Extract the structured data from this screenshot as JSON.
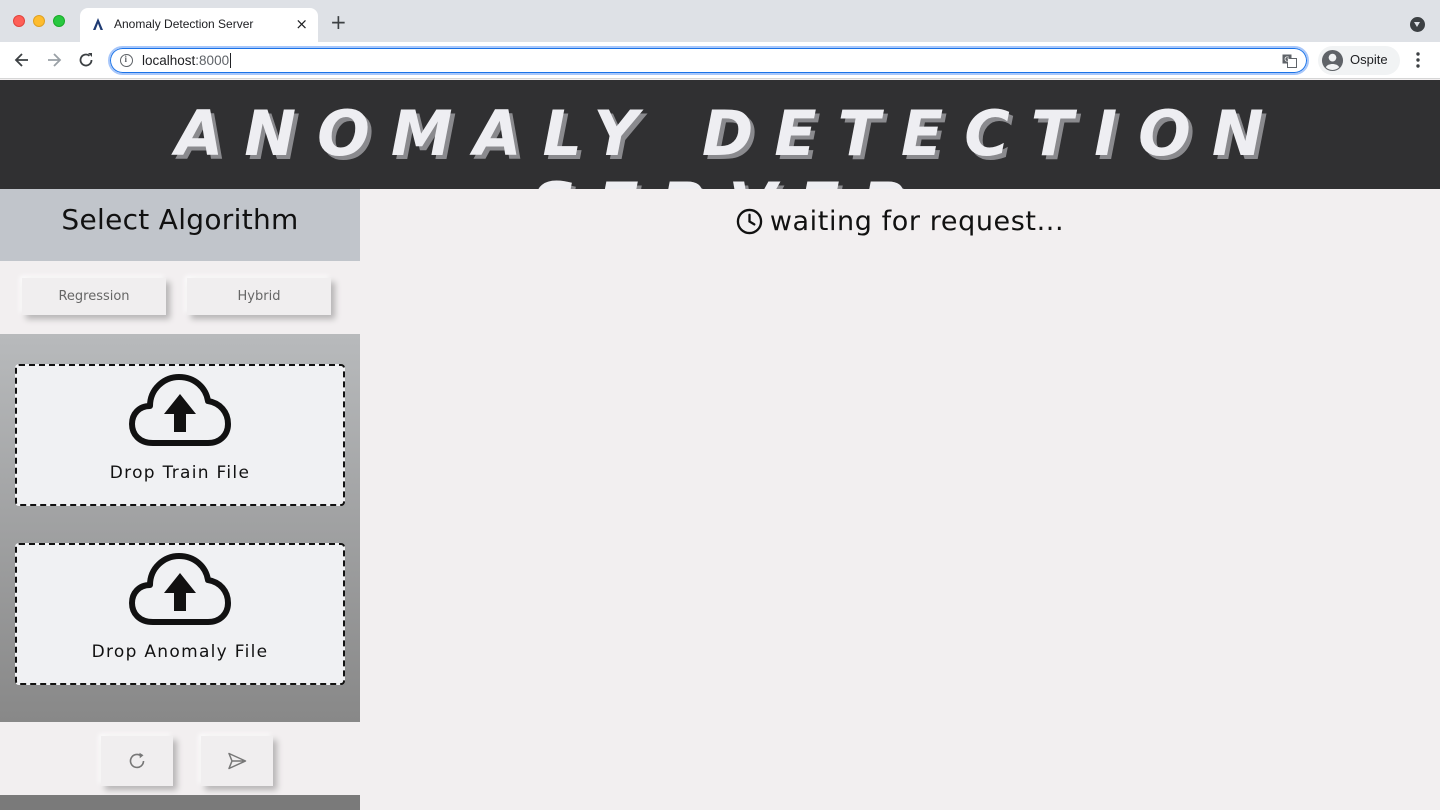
{
  "browser": {
    "tab_title": "Anomaly Detection Server",
    "tab_close": "×",
    "new_tab": "+",
    "url_host": "localhost",
    "url_port": ":8000",
    "profile_name": "Ospite"
  },
  "header": {
    "title": "ANOMALY DETECTION SERVER"
  },
  "sidebar": {
    "title": "Select Algorithm",
    "algorithms": [
      "Regression",
      "Hybrid"
    ],
    "drop_train_label": "Drop Train File",
    "drop_anomaly_label": "Drop Anomaly File"
  },
  "main": {
    "status": "waiting for request..."
  },
  "icons": {
    "upload": "cloud-upload-icon",
    "reset": "refresh-icon",
    "send": "send-icon",
    "status": "clock-icon"
  }
}
